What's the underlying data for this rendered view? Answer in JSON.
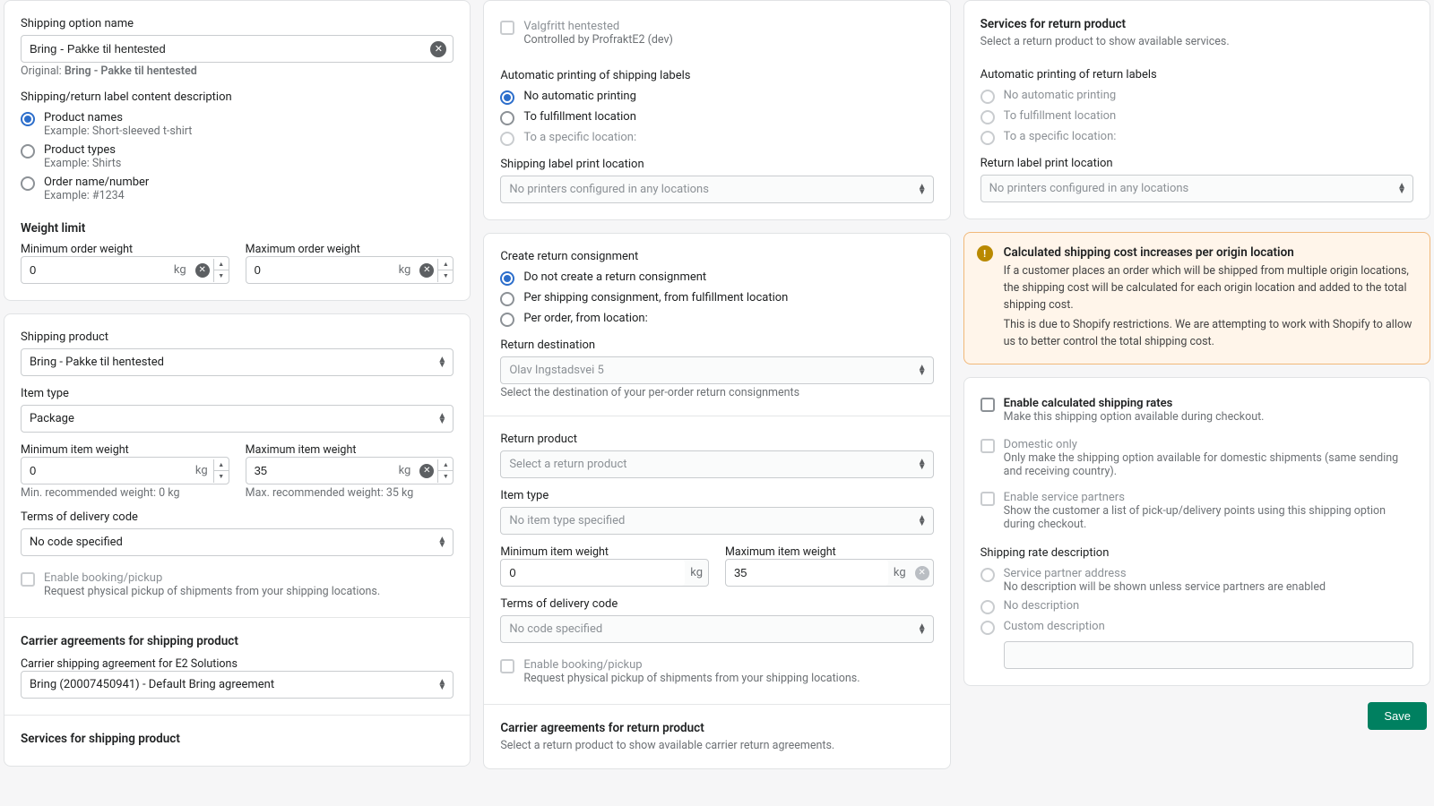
{
  "col1": {
    "card1": {
      "name_label": "Shipping option name",
      "name_value": "Bring - Pakke til hentested",
      "original_prefix": "Original: ",
      "original_value": "Bring - Pakke til hentested",
      "desc_label": "Shipping/return label content description",
      "opts": [
        {
          "label": "Product names",
          "example": "Example: Short-sleeved t-shirt",
          "checked": true
        },
        {
          "label": "Product types",
          "example": "Example: Shirts",
          "checked": false
        },
        {
          "label": "Order name/number",
          "example": "Example: #1234",
          "checked": false
        }
      ],
      "weight_title": "Weight limit",
      "min_label": "Minimum order weight",
      "min_val": "0",
      "max_label": "Maximum order weight",
      "max_val": "0",
      "unit": "kg"
    },
    "card2": {
      "ship_prod_label": "Shipping product",
      "ship_prod_val": "Bring - Pakke til hentested",
      "item_type_label": "Item type",
      "item_type_val": "Package",
      "min_item_label": "Minimum item weight",
      "min_item_val": "0",
      "min_rec": "Min. recommended weight: 0 kg",
      "max_item_label": "Maximum item weight",
      "max_item_val": "35",
      "max_rec": "Max. recommended weight: 35 kg",
      "tod_label": "Terms of delivery code",
      "tod_val": "No code specified",
      "booking_label": "Enable booking/pickup",
      "booking_sub": "Request physical pickup of shipments from your shipping locations.",
      "agreements_title": "Carrier agreements for shipping product",
      "agreement_label": "Carrier shipping agreement for E2 Solutions",
      "agreement_val": "Bring (20007450941) - Default Bring agreement",
      "services_title": "Services for shipping product",
      "unit": "kg"
    }
  },
  "col2": {
    "card1": {
      "valgfritt_label": "Valgfritt hentested",
      "valgfritt_sub": "Controlled by ProfraktE2 (dev)",
      "autoprint_title": "Automatic printing of shipping labels",
      "autoprint_opts": [
        {
          "label": "No automatic printing",
          "checked": true,
          "disabled": false
        },
        {
          "label": "To fulfillment location",
          "checked": false,
          "disabled": false
        },
        {
          "label": "To a specific location:",
          "checked": false,
          "disabled": true
        }
      ],
      "printloc_label": "Shipping label print location",
      "printloc_val": "No printers configured in any locations"
    },
    "card2": {
      "create_title": "Create return consignment",
      "create_opts": [
        {
          "label": "Do not create a return consignment",
          "checked": true
        },
        {
          "label": "Per shipping consignment, from fulfillment location",
          "checked": false
        },
        {
          "label": "Per order, from location:",
          "checked": false
        }
      ],
      "dest_label": "Return destination",
      "dest_val": "Olav Ingstadsvei 5",
      "dest_sub": "Select the destination of your per-order return consignments",
      "ret_prod_label": "Return product",
      "ret_prod_val": "Select a return product",
      "item_type_label": "Item type",
      "item_type_val": "No item type specified",
      "min_label": "Minimum item weight",
      "min_val": "0",
      "max_label": "Maximum item weight",
      "max_val": "35",
      "tod_label": "Terms of delivery code",
      "tod_val": "No code specified",
      "booking_label": "Enable booking/pickup",
      "booking_sub": "Request physical pickup of shipments from your shipping locations.",
      "agreements_title": "Carrier agreements for return product",
      "agreements_sub": "Select a return product to show available carrier return agreements.",
      "unit": "kg"
    }
  },
  "col3": {
    "card1": {
      "services_title": "Services for return product",
      "services_sub": "Select a return product to show available services.",
      "autoprint_title": "Automatic printing of return labels",
      "autoprint_opts": [
        {
          "label": "No automatic printing"
        },
        {
          "label": "To fulfillment location"
        },
        {
          "label": "To a specific location:"
        }
      ],
      "printloc_label": "Return label print location",
      "printloc_val": "No printers configured in any locations"
    },
    "banner": {
      "title": "Calculated shipping cost increases per origin location",
      "p1": "If a customer places an order which will be shipped from multiple origin locations, the shipping cost will be calculated for each origin location and added to the total shipping cost.",
      "p2": "This is due to Shopify restrictions. We are attempting to work with Shopify to allow us to better control the total shipping cost."
    },
    "card2": {
      "enable_label": "Enable calculated shipping rates",
      "enable_sub": "Make this shipping option available during checkout.",
      "domestic_label": "Domestic only",
      "domestic_sub": "Only make the shipping option available for domestic shipments (same sending and receiving country).",
      "partners_label": "Enable service partners",
      "partners_sub": "Show the customer a list of pick-up/delivery points using this shipping option during checkout.",
      "rate_desc_title": "Shipping rate description",
      "rate_opts": [
        {
          "label": "Service partner address",
          "sub": "No description will be shown unless service partners are enabled",
          "disabled": true
        },
        {
          "label": "No description",
          "disabled": true
        },
        {
          "label": "Custom description",
          "disabled": true
        }
      ]
    },
    "save": "Save"
  }
}
